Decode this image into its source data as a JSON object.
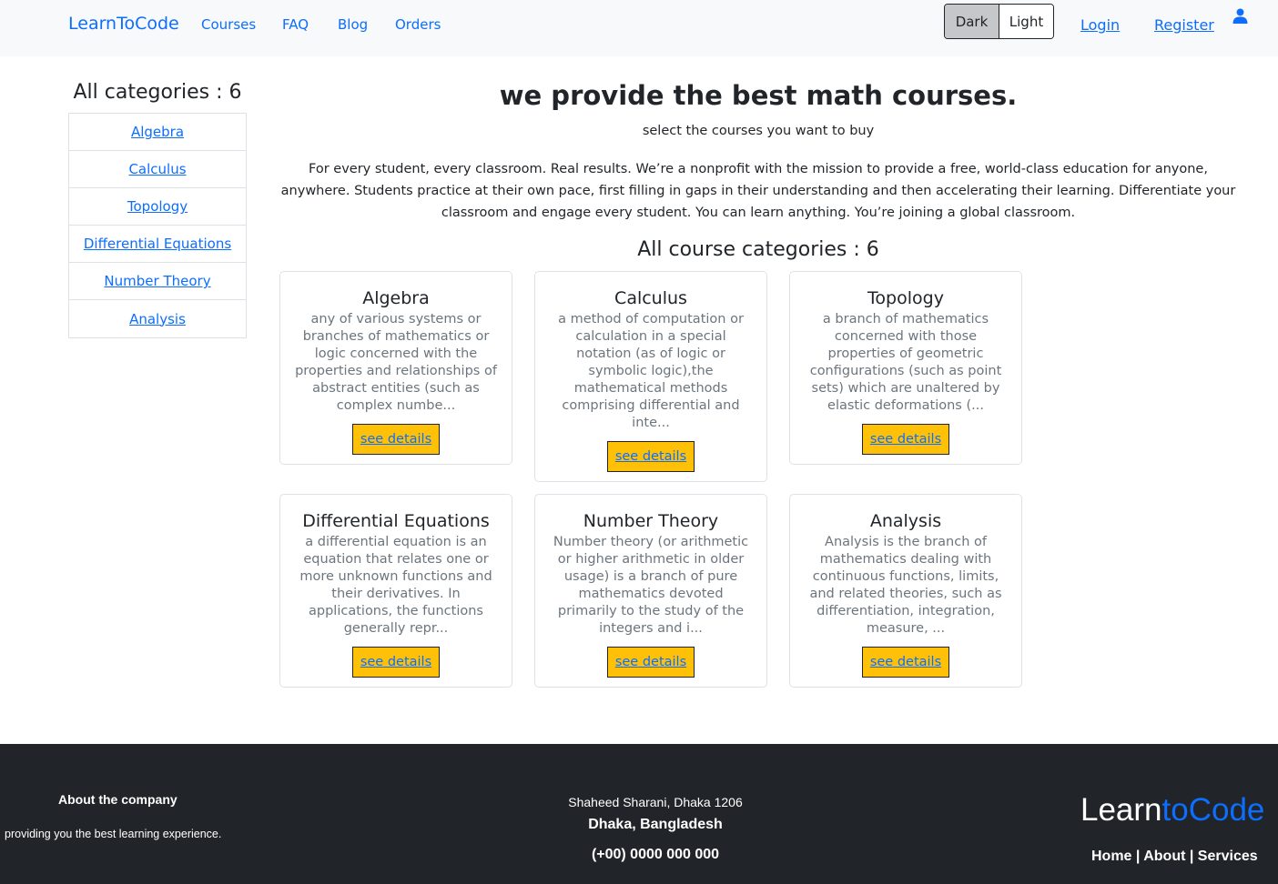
{
  "nav": {
    "brand": "LearnToCode",
    "links": [
      "Courses",
      "FAQ",
      "Blog",
      "Orders"
    ],
    "theme": {
      "dark": "Dark",
      "light": "Light",
      "selected": "Dark"
    },
    "login": "Login",
    "register": "Register",
    "user_icon": "user-icon"
  },
  "sidebar": {
    "title": "All categories : 6",
    "items": [
      "Algebra",
      "Calculus",
      "Topology",
      "Differential Equations",
      "Number Theory",
      "Analysis"
    ]
  },
  "hero": {
    "title": "we provide the best math courses.",
    "subtitle": "select the courses you want to buy",
    "description": "For every student, every classroom. Real results. We’re a nonprofit with the mission to provide a free, world-class education for anyone, anywhere. Students practice at their own pace, first filling in gaps in their understanding and then accelerating their learning. Differentiate your classroom and engage every student. You can learn anything. You’re joining a global classroom."
  },
  "courses": {
    "title": "All course categories : 6",
    "button_label": "see details",
    "cards": [
      {
        "title": "Algebra",
        "text": "any of various systems or branches of mathematics or logic concerned with the properties and relationships of abstract entities (such as complex numbe..."
      },
      {
        "title": "Calculus",
        "text": "a method of computation or calculation in a special notation (as of logic or symbolic logic),the mathematical methods comprising differential and inte..."
      },
      {
        "title": "Topology",
        "text": "a branch of mathematics concerned with those properties of geometric configurations (such as point sets) which are unaltered by elastic deformations (..."
      },
      {
        "title": "Differential Equations",
        "text": "a differential equation is an equation that relates one or more unknown functions and their derivatives. In applications, the functions generally repr..."
      },
      {
        "title": "Number Theory",
        "text": "Number theory (or arithmetic or higher arithmetic in older usage) is a branch of pure mathematics devoted primarily to the study of the integers and i..."
      },
      {
        "title": "Analysis",
        "text": "Analysis is the branch of mathematics dealing with continuous functions, limits, and related theories, such as differentiation, integration, measure, ..."
      }
    ]
  },
  "footer": {
    "about_title": "About the company",
    "about_text": "providing you the best learning experience.",
    "address_line1": "Shaheed Sharani, Dhaka 1206",
    "address_line2": "Dhaka, Bangladesh",
    "phone": "(+00) 0000 000 000",
    "logo_part1": "Learn",
    "logo_part2": "toCode",
    "links": "Home | About | Services"
  },
  "colors": {
    "primary": "#0d6efd",
    "warning": "#ffc107",
    "footer_bg": "#212529",
    "navbar_bg": "#f8f9fa",
    "muted_text": "#6c757d"
  }
}
